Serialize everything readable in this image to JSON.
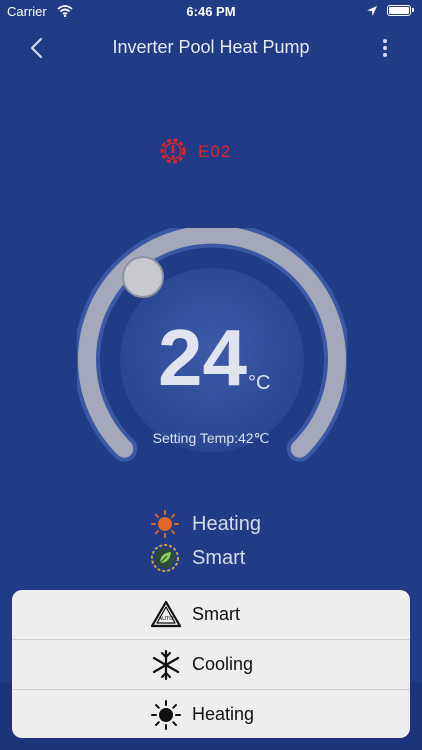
{
  "status_bar": {
    "carrier": "Carrier",
    "time": "6:46 PM"
  },
  "header": {
    "title": "Inverter Pool Heat Pump"
  },
  "error": {
    "code": "E02"
  },
  "thermostat": {
    "current_temp": "24",
    "unit": "°C",
    "setting_text": "Setting Temp:42℃"
  },
  "modes": [
    {
      "label": "Heating",
      "icon": "sun-icon"
    },
    {
      "label": "Smart",
      "icon": "leaf-icon"
    }
  ],
  "popup": {
    "options": [
      {
        "label": "Smart",
        "icon": "recycle-icon"
      },
      {
        "label": "Cooling",
        "icon": "snowflake-icon"
      },
      {
        "label": "Heating",
        "icon": "sun-icon"
      }
    ]
  },
  "colors": {
    "background": "#213b86",
    "error": "#d9262a",
    "heating_icon": "#e0662a",
    "popup_bg": "#eeeeef"
  }
}
